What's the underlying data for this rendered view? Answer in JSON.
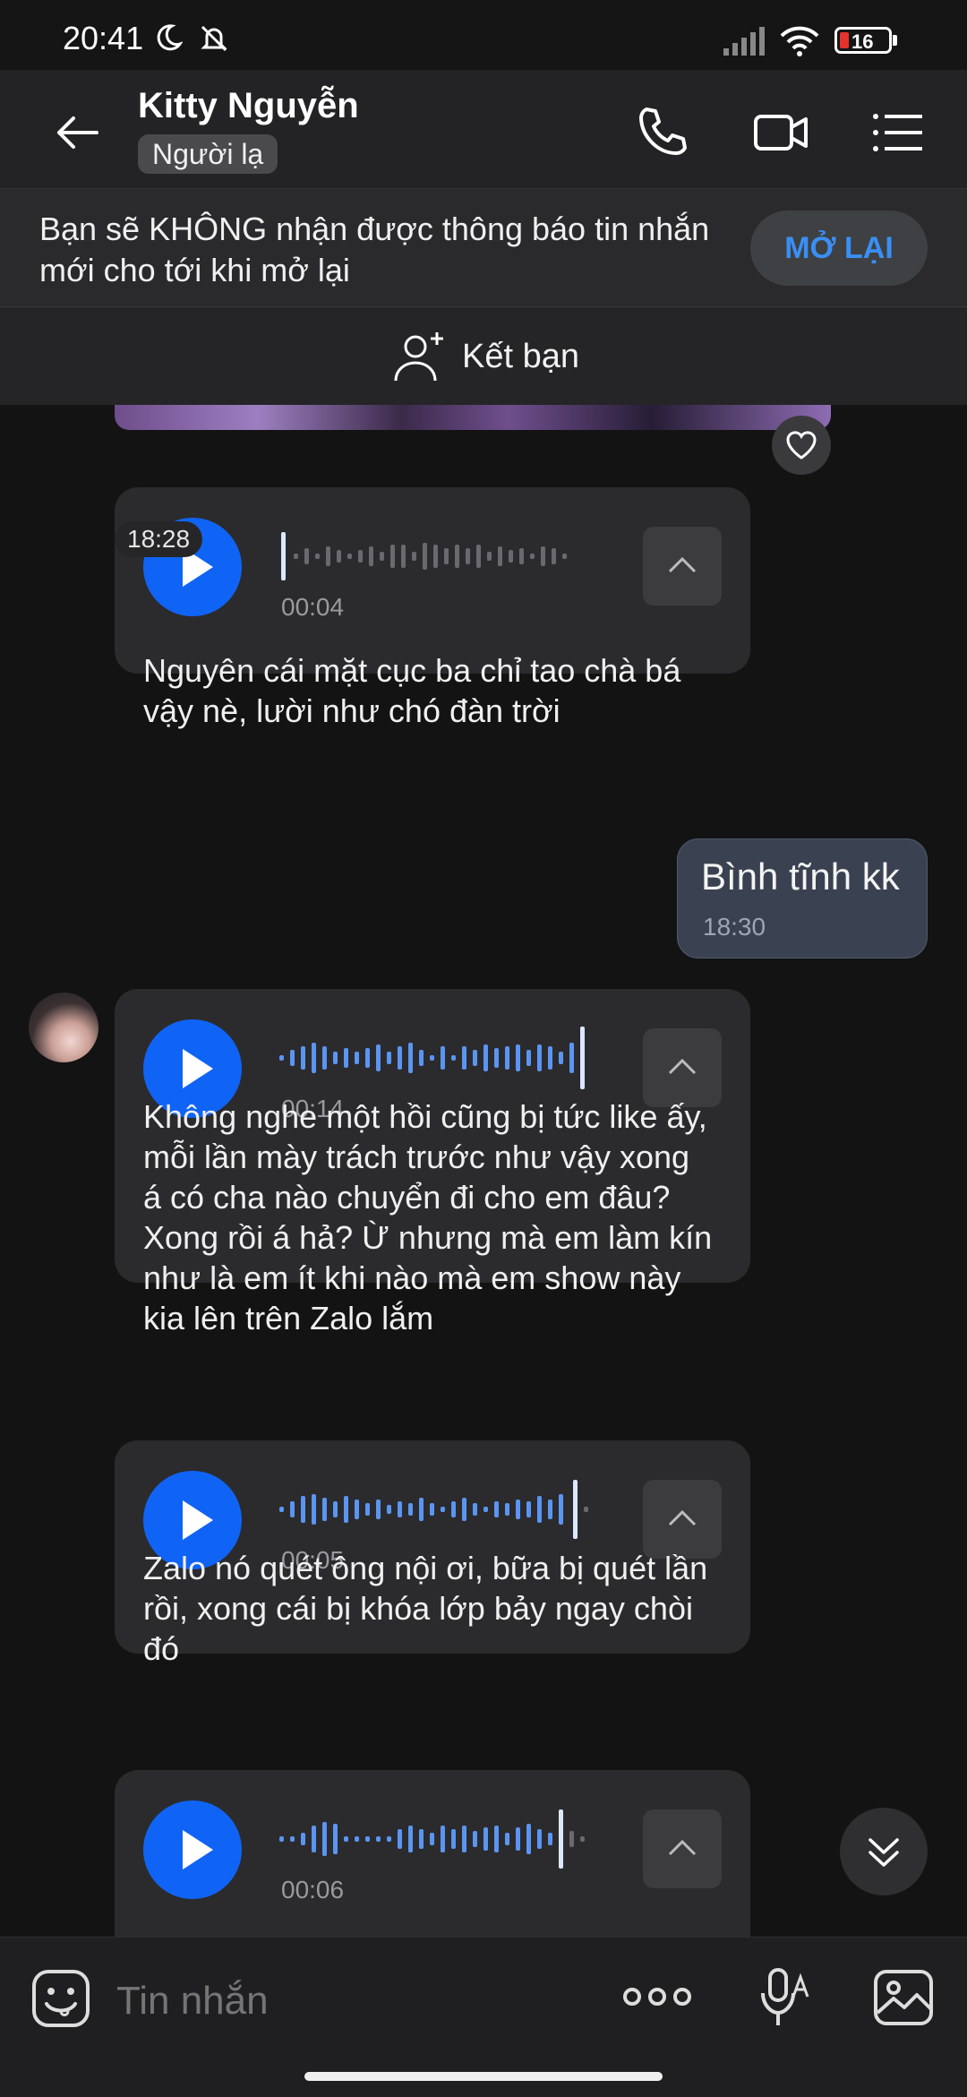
{
  "status_bar": {
    "time": "20:41",
    "battery": "16"
  },
  "header": {
    "contact_name": "Kitty Nguyễn",
    "badge": "Người lạ"
  },
  "mute_banner": {
    "text": "Bạn sẽ KHÔNG nhận được thông báo tin nhắn mới cho tới khi mở lại",
    "button": "MỞ LẠI"
  },
  "add_friend": {
    "label": "Kết bạn"
  },
  "messages": {
    "voice1": {
      "duration": "00:04",
      "transcript": "Nguyên cái mặt cục ba chỉ tao chà bá vậy nè, lười như chó đàn trời"
    },
    "time_chip": "18:28",
    "my_msg": {
      "text": "Bình tĩnh kk",
      "time": "18:30"
    },
    "voice2": {
      "duration": "00:14",
      "transcript": "Không nghe một hồi cũng bị tức like ấy, mỗi lần mày trách trước như vậy xong á có cha nào chuyển đi cho em đâu? Xong rồi á hả? Ừ nhưng mà em làm kín như là em ít khi nào mà em show này kia lên trên Zalo lắm"
    },
    "voice3": {
      "duration": "00:05",
      "transcript": "Zalo nó quét ông nội ơi, bữa bị quét lần rồi, xong cái bị khóa lớp bảy ngay chòi đó"
    },
    "voice4": {
      "duration": "00:06"
    }
  },
  "input": {
    "placeholder": "Tin nhắn"
  },
  "colors": {
    "accent": "#1064f5",
    "link": "#3a8ff5",
    "background": "#131314",
    "bubble": "#2b2b2d",
    "my_bubble": "#3a4251"
  },
  "icons": [
    "back-arrow-icon",
    "phone-icon",
    "video-icon",
    "menu-list-icon",
    "add-friend-icon",
    "heart-icon",
    "play-icon",
    "chevron-up-icon",
    "chevron-double-down-icon",
    "emoji-icon",
    "more-dots-icon",
    "voice-text-icon",
    "image-icon"
  ]
}
